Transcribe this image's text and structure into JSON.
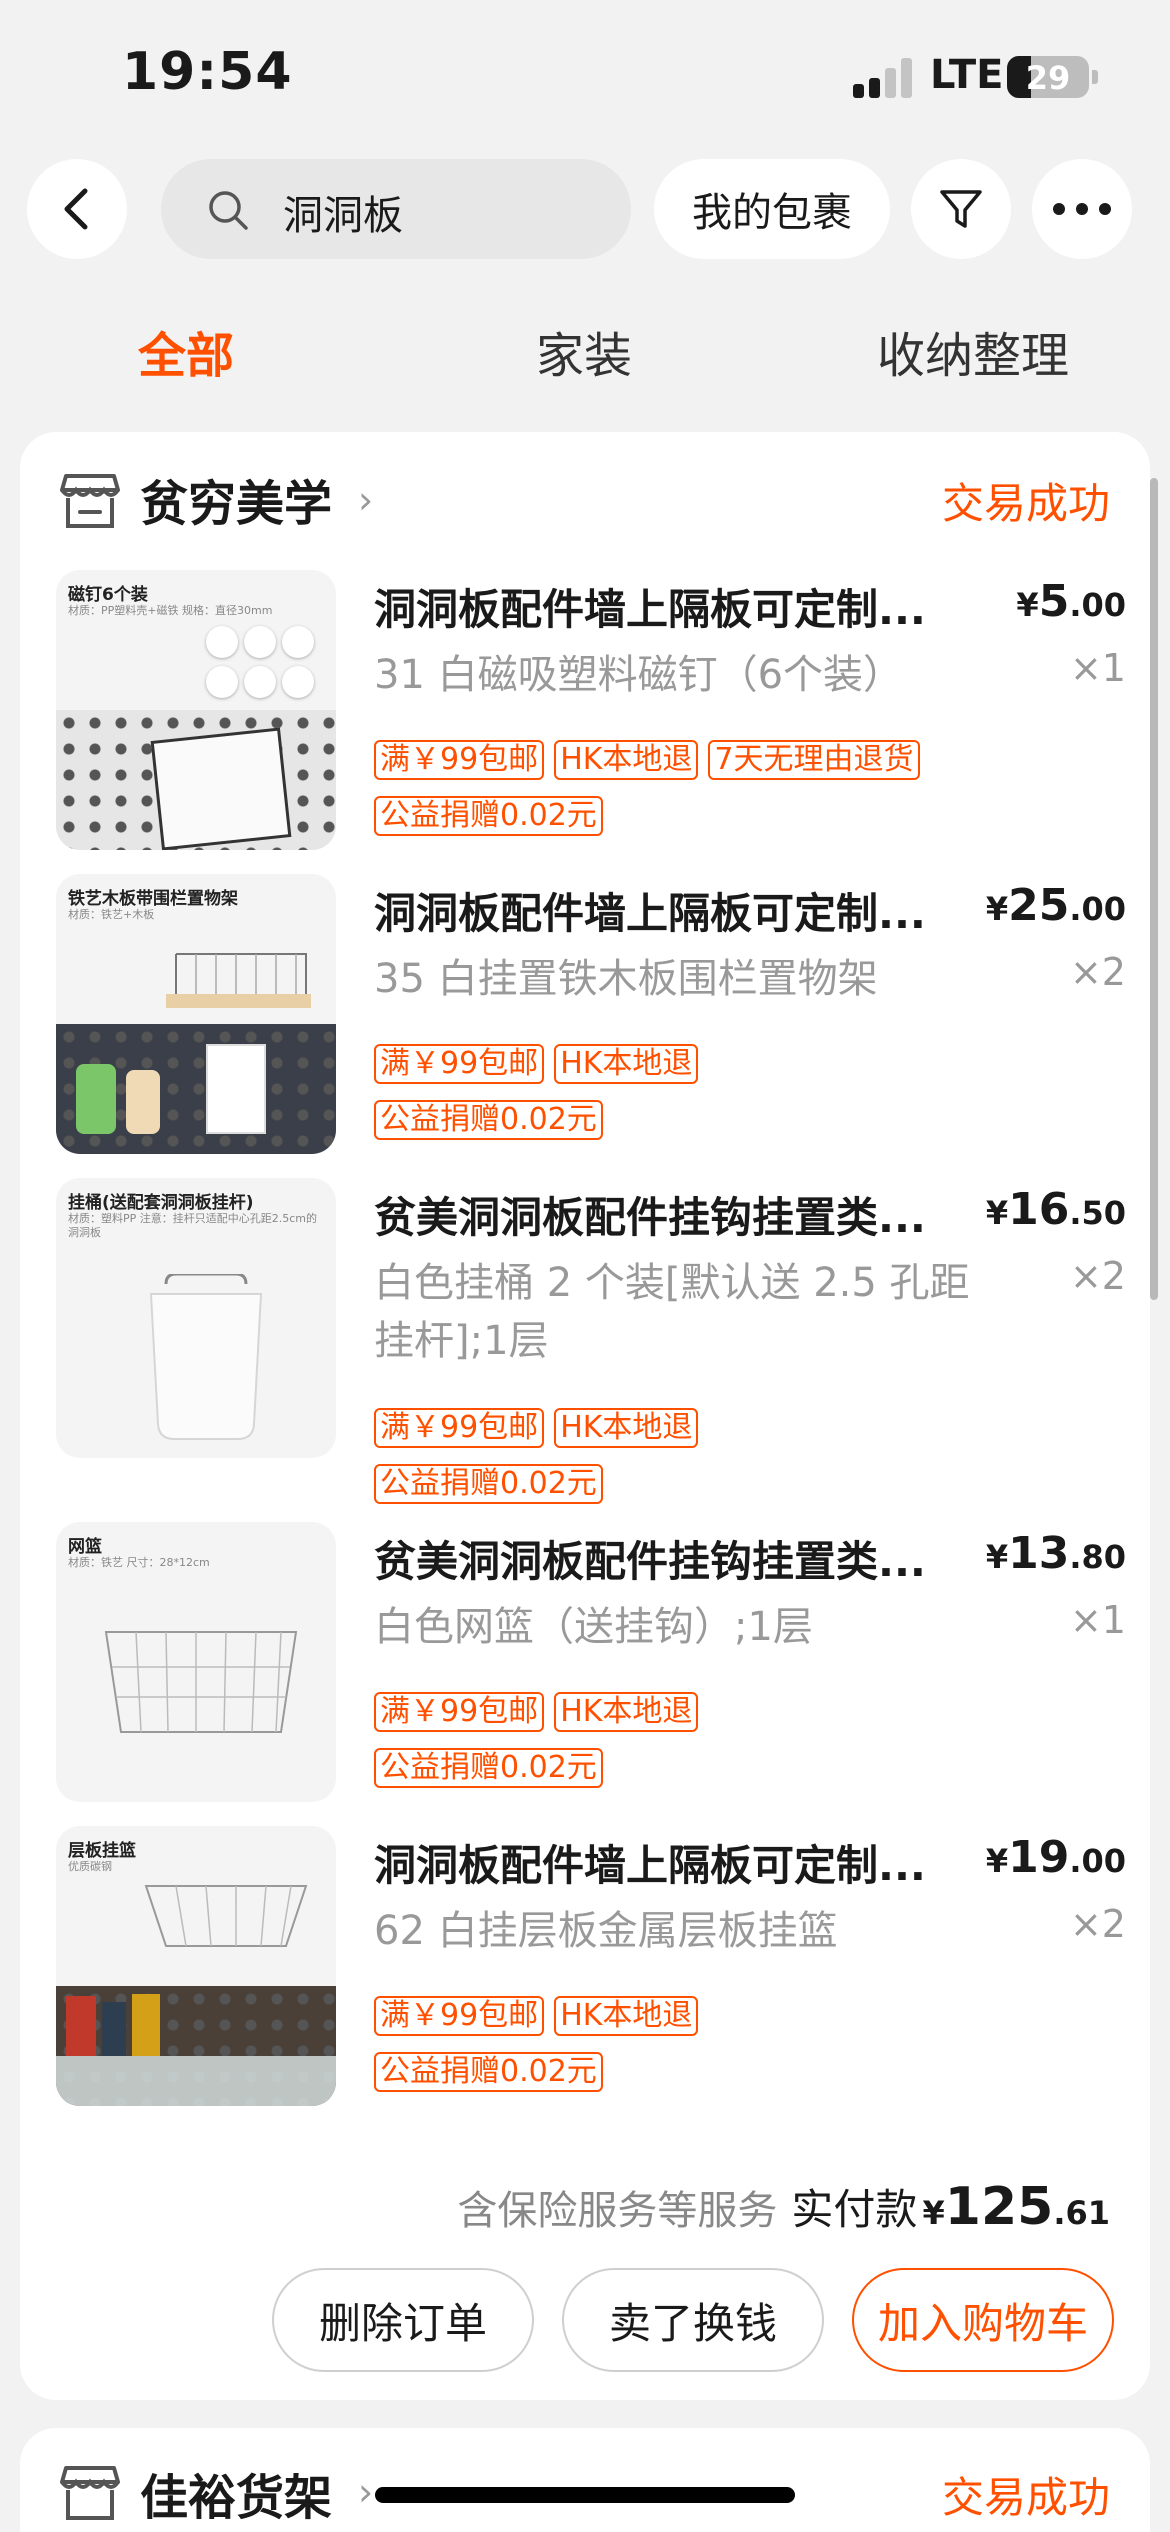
{
  "status": {
    "time": "19:54",
    "network": "LTE",
    "battery": "29",
    "battery_level": 0.29
  },
  "search": {
    "query": "洞洞板"
  },
  "top": {
    "my_parcels": "我的包裹",
    "back_icon": "back-arrow-icon",
    "filter_icon": "filter-icon",
    "more_icon": "more-icon"
  },
  "tabs": [
    {
      "label": "全部",
      "active": true
    },
    {
      "label": "家装"
    },
    {
      "label": "收纳整理"
    }
  ],
  "order": {
    "shop_name": "贫穷美学",
    "status": "交易成功",
    "items": [
      {
        "title": "洞洞板配件墙上隔板可定制...",
        "spec": "31 白磁吸塑料磁钉（6个装）",
        "price_currency": "¥",
        "price_int": "5",
        "price_dec": ".00",
        "qty": "×1",
        "tags_row1": [
          "满￥99包邮",
          "HK本地退",
          "7天无理由退货"
        ],
        "tags_row2": [
          "公益捐赠0.02元"
        ],
        "thumb": {
          "label": "磁钉6个装",
          "sub": "材质：PP塑料壳+磁铁  规格：直径30mm"
        }
      },
      {
        "title": "洞洞板配件墙上隔板可定制...",
        "spec": "35 白挂置铁木板围栏置物架",
        "price_currency": "¥",
        "price_int": "25",
        "price_dec": ".00",
        "qty": "×2",
        "tags_row1": [
          "满￥99包邮",
          "HK本地退"
        ],
        "tags_row2": [
          "公益捐赠0.02元"
        ],
        "thumb": {
          "label": "铁艺木板带围栏置物架",
          "sub": "材质：铁艺+木板"
        }
      },
      {
        "title": "贫美洞洞板配件挂钩挂置类...",
        "spec": "白色挂桶 2 个装[默认送 2.5 孔距挂杆];1层",
        "price_currency": "¥",
        "price_int": "16",
        "price_dec": ".50",
        "qty": "×2",
        "tags_row1": [
          "满￥99包邮",
          "HK本地退"
        ],
        "tags_row2": [
          "公益捐赠0.02元"
        ],
        "thumb": {
          "label": "挂桶(送配套洞洞板挂杆)",
          "sub": "材质：塑料PP 注意：挂杆只适配中心孔距2.5cm的洞洞板"
        }
      },
      {
        "title": "贫美洞洞板配件挂钩挂置类...",
        "spec": "白色网篮（送挂钩）;1层",
        "price_currency": "¥",
        "price_int": "13",
        "price_dec": ".80",
        "qty": "×1",
        "tags_row1": [
          "满￥99包邮",
          "HK本地退"
        ],
        "tags_row2": [
          "公益捐赠0.02元"
        ],
        "thumb": {
          "label": "网篮",
          "sub": "材质：铁艺 尺寸：28*12cm"
        }
      },
      {
        "title": "洞洞板配件墙上隔板可定制...",
        "spec": "62 白挂层板金属层板挂篮",
        "price_currency": "¥",
        "price_int": "19",
        "price_dec": ".00",
        "qty": "×2",
        "tags_row1": [
          "满￥99包邮",
          "HK本地退"
        ],
        "tags_row2": [
          "公益捐赠0.02元"
        ],
        "thumb": {
          "label": "层板挂篮",
          "sub": "优质碳钢"
        }
      }
    ],
    "services_note": "含保险服务等服务",
    "paid_label": "实付款",
    "total_currency": "¥",
    "total_int": "125",
    "total_dec": ".61",
    "actions": [
      "删除订单",
      "卖了换钱",
      "加入购物车"
    ]
  },
  "next_order": {
    "shop_name": "佳裕货架",
    "status": "交易成功"
  },
  "colors": {
    "accent": "#ff5000",
    "background": "#f2f2f2",
    "card": "#ffffff"
  }
}
